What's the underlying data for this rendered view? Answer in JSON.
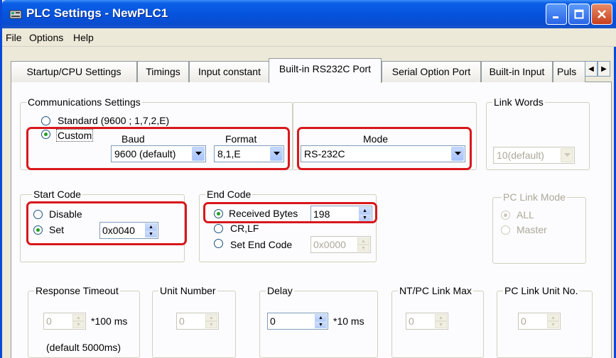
{
  "window": {
    "title": "PLC Settings - NewPLC1"
  },
  "menu": [
    "File",
    "Options",
    "Help"
  ],
  "tabs": [
    "Startup/CPU Settings",
    "Timings",
    "Input constant",
    "Built-in RS232C Port",
    "Serial Option Port",
    "Built-in Input",
    "Puls"
  ],
  "comm": {
    "group_label": "Communications Settings",
    "standard_label": "Standard (9600 ; 1,7,2,E)",
    "custom_label": "Custom",
    "baud_label": "Baud",
    "baud_value": "9600 (default)",
    "format_label": "Format",
    "format_value": "8,1,E",
    "mode_label": "Mode",
    "mode_value": "RS-232C"
  },
  "link_words": {
    "label": "Link Words",
    "value": "10(default)"
  },
  "start_code": {
    "label": "Start Code",
    "disable_label": "Disable",
    "set_label": "Set",
    "value": "0x0040"
  },
  "end_code": {
    "label": "End Code",
    "received_label": "Received Bytes",
    "received_value": "198",
    "crlf_label": "CR,LF",
    "set_end_label": "Set End Code",
    "set_end_value": "0x0000"
  },
  "pc_link_mode": {
    "label": "PC Link Mode",
    "all_label": "ALL",
    "master_label": "Master"
  },
  "response_timeout": {
    "label": "Response Timeout",
    "value": "0",
    "unit": "*100 ms",
    "note": "(default 5000ms)"
  },
  "unit_number": {
    "label": "Unit Number",
    "value": "0"
  },
  "delay": {
    "label": "Delay",
    "value": "0",
    "unit": "*10 ms"
  },
  "nt_pc_link_max": {
    "label": "NT/PC Link Max",
    "value": "0"
  },
  "pc_link_unit_no": {
    "label": "PC Link Unit No.",
    "value": "0"
  },
  "colors": {
    "titlebar": "#0a5fe6",
    "highlight": "#d8171c",
    "radio_dot": "#21a121"
  }
}
